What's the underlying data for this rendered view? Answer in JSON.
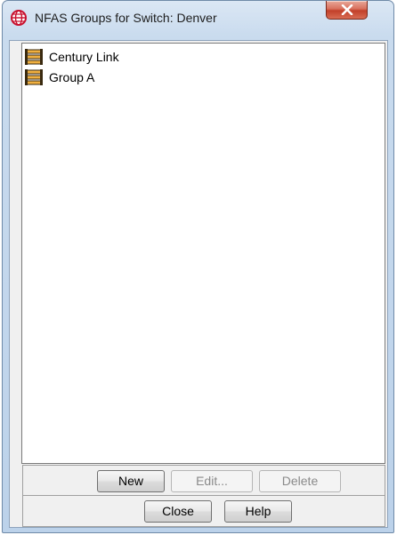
{
  "window": {
    "title": "NFAS Groups for Switch: Denver"
  },
  "list": {
    "items": [
      {
        "label": "Century Link",
        "icon": "nfas-group-icon"
      },
      {
        "label": "Group A",
        "icon": "nfas-group-icon"
      }
    ]
  },
  "buttons": {
    "new_label": "New",
    "edit_label": "Edit...",
    "delete_label": "Delete",
    "close_label": "Close",
    "help_label": "Help"
  },
  "colors": {
    "frame": "#c9dbee",
    "close_button": "#c2402a",
    "app_icon": "#c8102e"
  }
}
